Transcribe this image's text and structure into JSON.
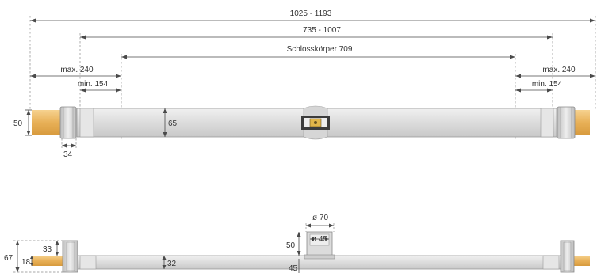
{
  "top_view": {
    "overall": "1025 - 1193",
    "middle": "735 - 1007",
    "lock_body": "Schlosskörper 709",
    "max_left": "max. 240",
    "max_right": "max. 240",
    "min_left": "min. 154",
    "min_right": "min. 154",
    "rod_height": "50",
    "bar_height": "65",
    "cap_width": "34"
  },
  "bottom_view": {
    "knob_diameter": "ø 70",
    "shaft_diameter": "ø 45",
    "knob_height": "50",
    "knob_offset": "45",
    "bar_height": "32",
    "total_height": "67",
    "cap_height": "33",
    "rod_height": "18"
  },
  "colors": {
    "rod": "#e8b057",
    "bar": "#dedede",
    "cap": "#cfcfcf",
    "dimension": "#4a4a4a"
  }
}
